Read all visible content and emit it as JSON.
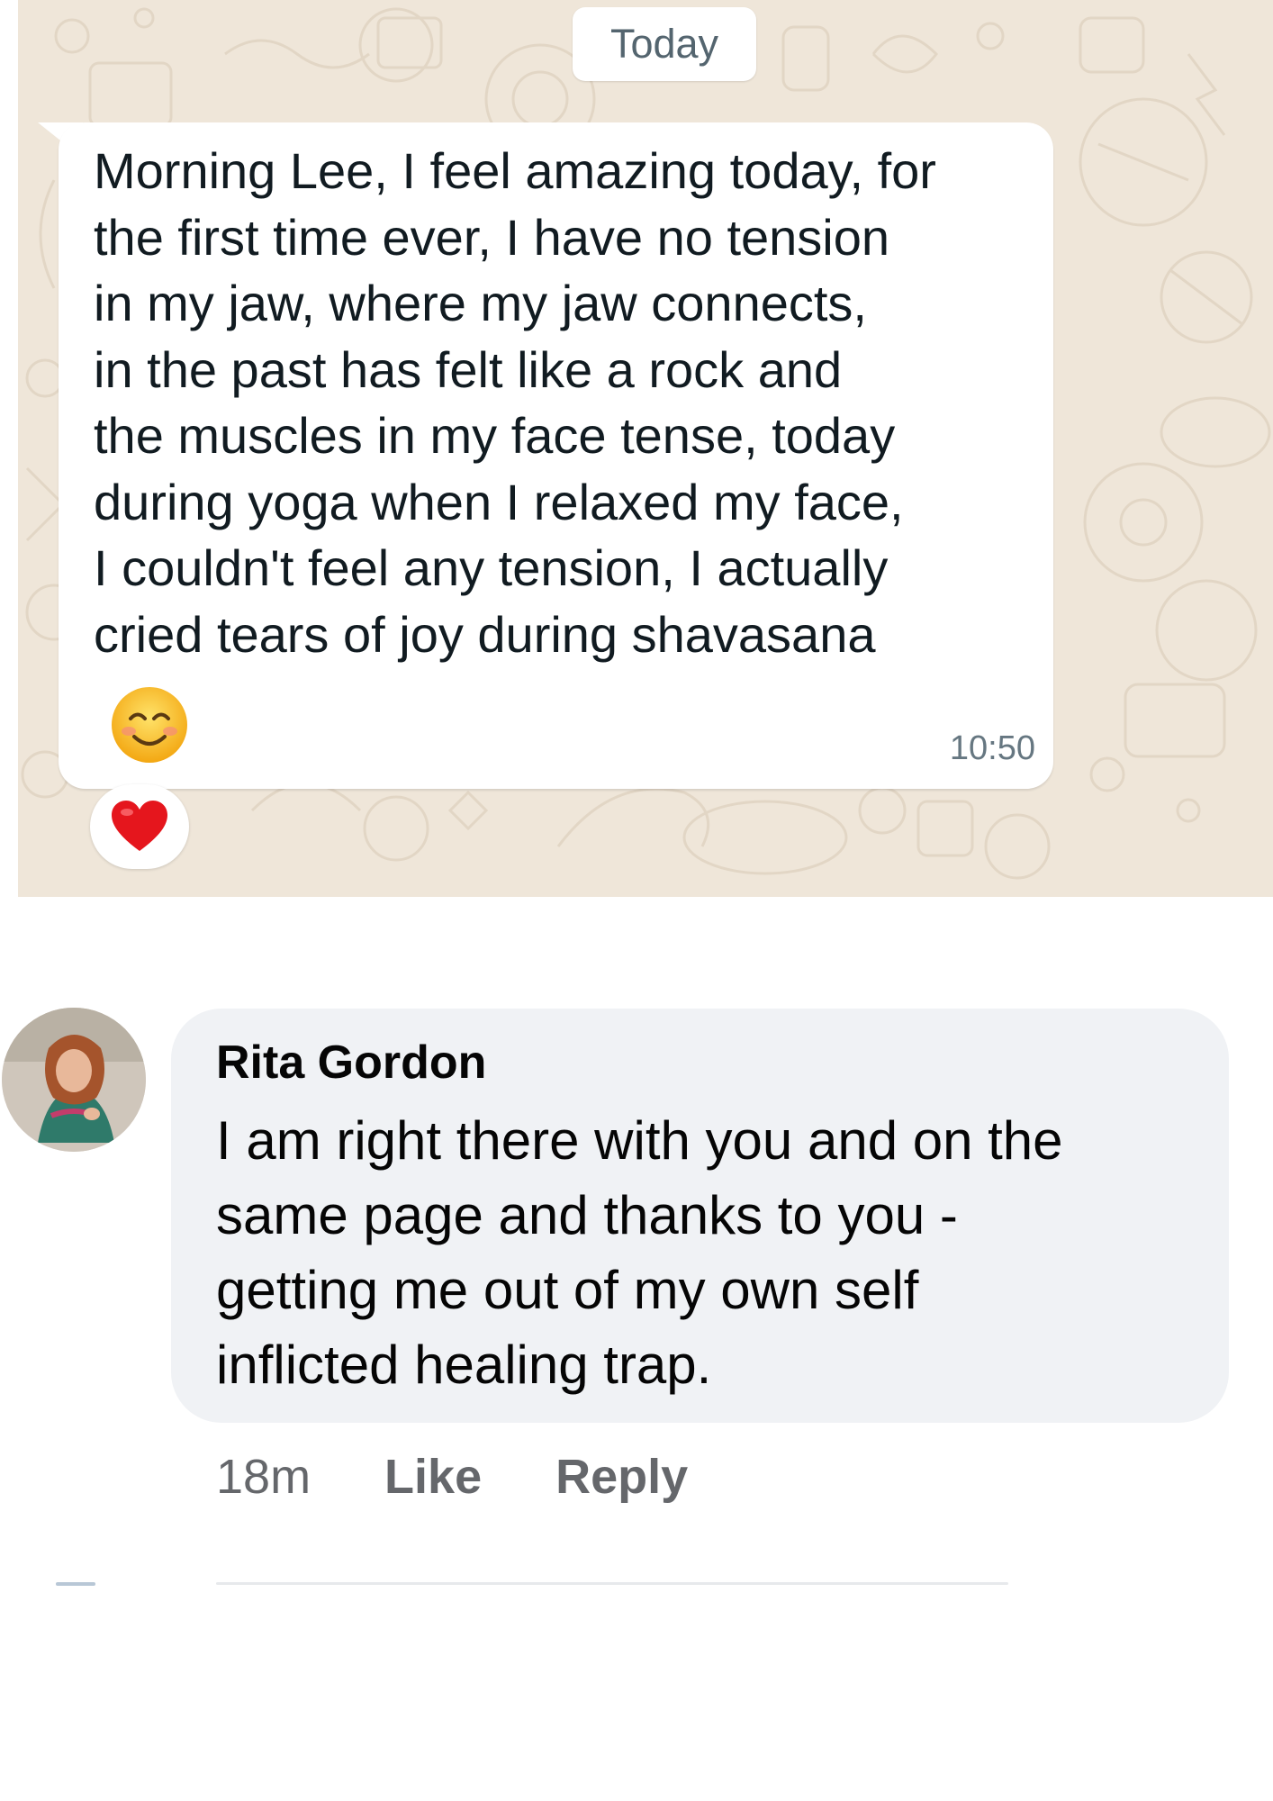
{
  "whatsapp": {
    "date_label": "Today",
    "message": {
      "text": "Morning Lee, I feel amazing today, for\nthe first time ever, I have no tension\nin my jaw, where my jaw connects,\nin the past has felt like a rock and\nthe muscles in my face tense, today\nduring yoga when I relaxed my face,\nI couldn't feel any tension, I actually\ncried tears of joy during shavasana",
      "emoji": "smiling-face-icon",
      "time": "10:50",
      "reaction": "red-heart-icon"
    },
    "colors": {
      "background": "#efe6d9",
      "bubble": "#ffffff",
      "time": "#667781"
    }
  },
  "comment": {
    "author": "Rita Gordon",
    "text": "I am right there with you and on the\nsame page and thanks to you -\ngetting me out of my own self\ninflicted healing trap.",
    "timestamp": "18m",
    "like_label": "Like",
    "reply_label": "Reply",
    "colors": {
      "bubble": "#f0f2f5",
      "text": "#050505",
      "meta": "#65676b"
    }
  }
}
